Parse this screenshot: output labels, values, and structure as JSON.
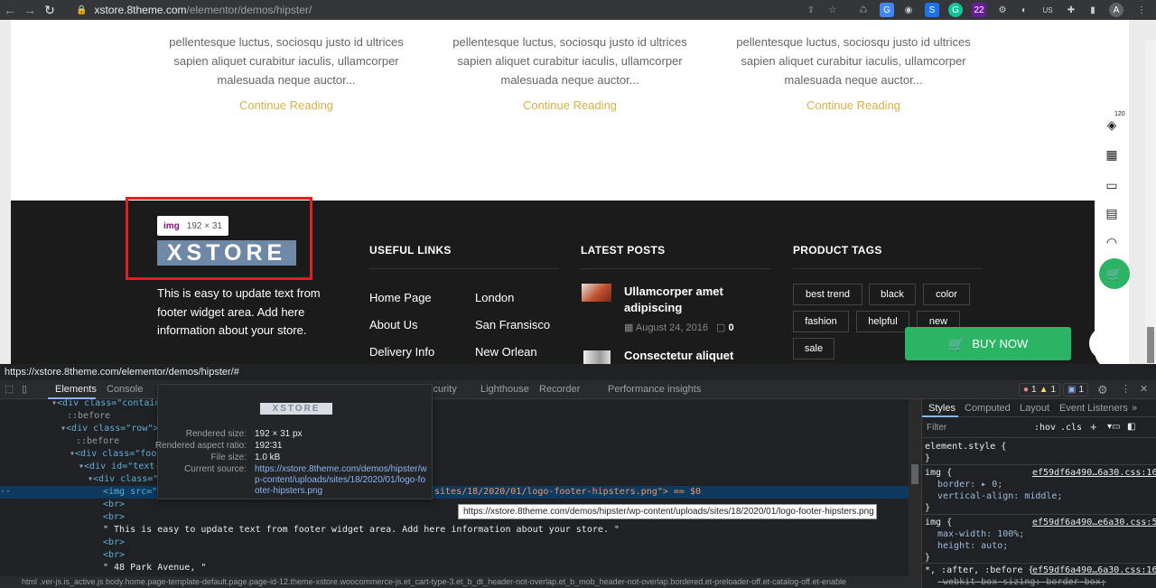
{
  "browser": {
    "url_host": "xstore.8theme.com",
    "url_path": "/elementor/demos/hipster/",
    "profile": "A",
    "ext_badge_22": "22",
    "ext_us": "US"
  },
  "posts": {
    "excerpt_lines": [
      "pellentesque luctus, sociosqu justo id ultrices",
      "sapien aliquet curabitur iaculis, ullamcorper",
      "malesuada neque auctor..."
    ],
    "continue": "Continue Reading"
  },
  "footer": {
    "logo_text": "XSTORE",
    "about": "This is easy to update text from footer widget area. Add here information about your store.",
    "useful_links_title": "USEFUL LINKS",
    "links_col1": [
      "Home Page",
      "About Us",
      "Delivery Info"
    ],
    "links_col2": [
      "London",
      "San Fransisco",
      "New Orlean"
    ],
    "latest_posts_title": "LATEST POSTS",
    "post1_title": "Ullamcorper amet adipiscing",
    "post1_date": "August 24, 2016",
    "post1_comments": "0",
    "post2_title": "Consectetur aliquet",
    "product_tags_title": "PRODUCT TAGS",
    "tags": [
      "best trend",
      "black",
      "color",
      "fashion",
      "helpful",
      "new",
      "sale"
    ],
    "buy_now": "BUY NOW"
  },
  "inspect_badge": {
    "tag": "img",
    "size": "192 × 31"
  },
  "sidebar": {
    "count": "120"
  },
  "status_url": "https://xstore.8theme.com/elementor/demos/hipster/#",
  "devtools": {
    "tabs": [
      "Elements",
      "Console",
      "Security",
      "Lighthouse",
      "Recorder",
      "Performance insights"
    ],
    "errors": "1",
    "warnings": "1",
    "info": "1",
    "code": {
      "l1": "<div class=\"containe",
      "l2": "::before",
      "l3": "<div class=\"row\">",
      "l4": "::before",
      "l5": "<div class=\"foote",
      "l6": "<div id=\"text-1",
      "l7": "<div class=\"t",
      "l8a": "<img src=\"ht",
      "l8b": "sites/18/2020/01/logo-footer-hipsters.png\"> == $0",
      "l9": "<br>",
      "l10": "<br>",
      "l11": "\" This is easy to update text from footer widget area. Add here information about your store. \"",
      "l12": "<br>",
      "l13": "<br>",
      "l14": "\" 48 Park Avenue, \""
    },
    "breadcrumb": "html .ver-js.is_active.js   body.home.page-template-default.page.page-id-12.theme-xstore.woocommerce-js.et_cart-type-3.et_b_dt_header-not-overlap.et_b_mob_header-not-overlap.bordered.et-preloader-off.et-catalog-off.et-enable",
    "tooltip": {
      "rendered_size_label": "Rendered size:",
      "rendered_size": "192 × 31 px",
      "aspect_label": "Rendered aspect ratio:",
      "aspect": "192∶31",
      "filesize_label": "File size:",
      "filesize": "1.0 kB",
      "source_label": "Current source:",
      "source": "https://xstore.8theme.com/demos/hipster/wp-content/uploads/sites/18/2020/01/logo-footer-hipsters.png"
    },
    "link_tooltip": "https://xstore.8theme.com/demos/hipster/wp-content/uploads/sites/18/2020/01/logo-footer-hipsters.png",
    "styles": {
      "tabs": [
        "Styles",
        "Computed",
        "Layout",
        "Event Listeners"
      ],
      "filter": "Filter",
      "hov": ":hov",
      ".cls": ".cls",
      "element_style": "element.style {",
      "close": "}",
      "r1_sel": "img {",
      "r1_src": "ef59df6a490…6a30.css:16",
      "r1_p1": "border: ▸ 0;",
      "r1_p2": "vertical-align: middle;",
      "r2_sel": "img {",
      "r2_src": "ef59df6a490…e6a30.css:5",
      "r2_p1": "max-width: 100%;",
      "r2_p2": "height: auto;",
      "r3_sel": "*, :after, :before {",
      "r3_src": "ef59df6a490…6a30.css:16",
      "r3_p1": "-webkit-box-sizing: border-box;",
      "r3_p2": "box-sizing: border-box;"
    }
  }
}
